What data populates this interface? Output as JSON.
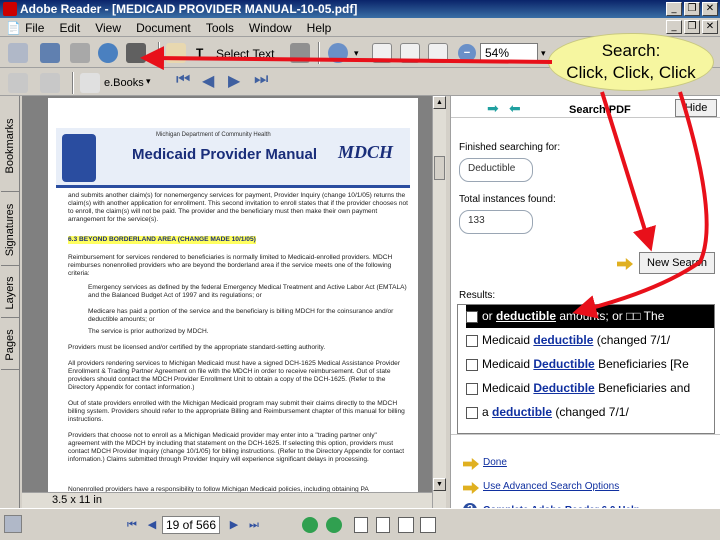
{
  "window": {
    "title": "Adobe Reader - [MEDICAID PROVIDER MANUAL-10-05.pdf]"
  },
  "menu": [
    "File",
    "Edit",
    "View",
    "Document",
    "Tools",
    "Window",
    "Help"
  ],
  "toolbar": {
    "select_text_label": "Select Text",
    "zoom_value": "54%",
    "ebooks_label": "e.Books"
  },
  "callout": {
    "line1": "Search:",
    "line2": "Click, Click, Click"
  },
  "side_tabs": [
    "Bookmarks",
    "Signatures",
    "Layers",
    "Pages"
  ],
  "page": {
    "dept": "Michigan Department of Community Health",
    "title": "Medicaid Provider Manual",
    "logo": "MDCH",
    "para1": "and submits another claim(s) for nonemergency services for payment, Provider Inquiry (change 10/1/05) returns the claim(s) with another application for enrollment. This second invitation to enroll states that if the provider chooses not to enroll, the claim(s) will not be paid. The provider and the beneficiary must then make their own payment arrangement for the service(s).",
    "section": "6.3 BEYOND BORDERLAND AREA (CHANGE MADE 10/1/05)",
    "para2": "Reimbursement for services rendered to beneficiaries is normally limited to Medicaid-enrolled providers. MDCH reimburses nonenrolled providers who are beyond the borderland area if the service meets one of the following criteria:",
    "bullet1": "Emergency services as defined by the federal Emergency Medical Treatment and Active Labor Act (EMTALA) and the Balanced Budget Act of 1997 and its regulations; or",
    "bullet2": "Medicare has paid a portion of the service and the beneficiary is billing MDCH for the coinsurance and/or deductible amounts; or",
    "bullet3": "The service is prior authorized by MDCH.",
    "para3": "Providers must be licensed and/or certified by the appropriate standard-setting authority.",
    "para4": "All providers rendering services to Michigan Medicaid must have a signed DCH-1625 Medical Assistance Provider Enrollment & Trading Partner Agreement on file with the MDCH in order to receive reimbursement. Out of state providers should contact the MDCH Provider Enrollment Unit to obtain a copy of the DCH-1625. (Refer to the Directory Appendix for contact information.)",
    "para5": "Out of state providers enrolled with the Michigan Medicaid program may submit their claims directly to the MDCH billing system. Providers should refer to the appropriate Billing and Reimbursement chapter of this manual for billing instructions.",
    "para6": "Providers that choose not to enroll as a Michigan Medicaid provider may enter into a \"trading partner only\" agreement with the MDCH by including that statement on the DCH-1625. If selecting this option, providers must contact MDCH Provider Inquiry (change 10/1/05) for billing instructions. (Refer to the Directory Appendix for contact information.) Claims submitted through Provider Inquiry will experience significant delays in processing.",
    "para7": "Nonenrolled providers have a responsibility to follow Michigan Medicaid policies, including obtaining PA"
  },
  "search": {
    "header": "Search PDF",
    "hide_label": "Hide",
    "finished_label": "Finished searching for:",
    "term": "Deductible",
    "instances_label": "Total instances found:",
    "instances": "133",
    "new_search_label": "New Search",
    "results_label": "Results:",
    "results": [
      {
        "pre": "or",
        "kw": "deductible",
        "post": "amounts; or □□ The"
      },
      {
        "pre": "Medicaid",
        "kw": "deductible",
        "post": "(changed 7/1/"
      },
      {
        "pre": "Medicaid",
        "kw": "Deductible",
        "post": "Beneficiaries [Re"
      },
      {
        "pre": "Medicaid",
        "kw": "Deductible",
        "post": "Beneficiaries and"
      },
      {
        "pre": "a",
        "kw": "deductible",
        "post": "(changed 7/1/"
      }
    ],
    "done_label": "Done",
    "advanced_label": "Use Advanced Search Options",
    "complete_label": "Complete Adobe Reader 6.0 Help"
  },
  "status": {
    "page_size": "3.5 x 11 in",
    "page_counter": "19 of 566"
  },
  "colors": {
    "titlebar": "#0a246a",
    "link": "#1030a0",
    "arrow": "#e8101a",
    "callout": "#f6f6a0"
  }
}
